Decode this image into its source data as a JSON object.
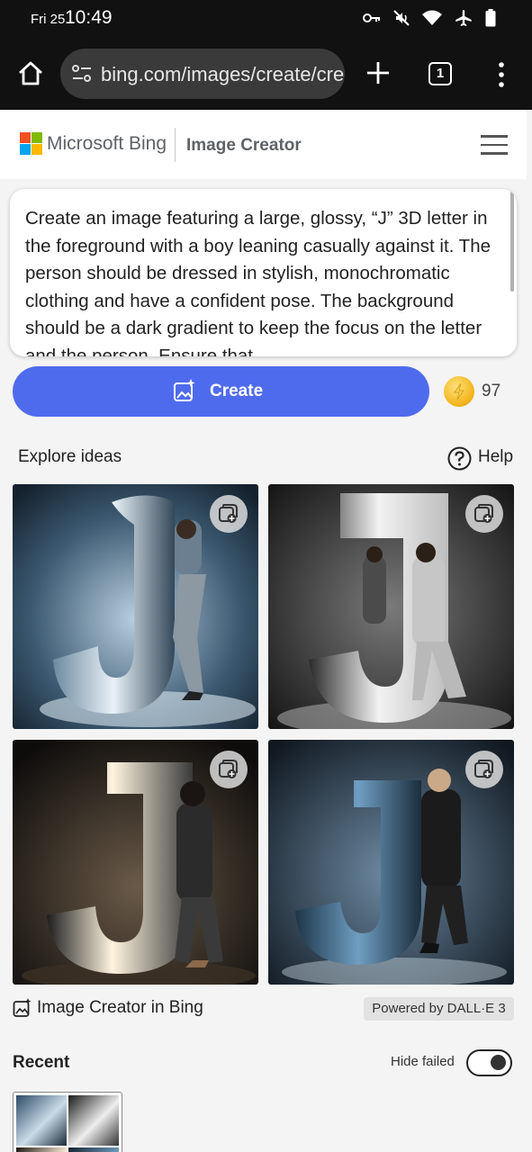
{
  "status_bar": {
    "date": "Fri 25",
    "time": "10:49",
    "icons": [
      "vpn-key-icon",
      "mute-icon",
      "wifi-icon",
      "airplane-icon",
      "battery-icon"
    ]
  },
  "browser": {
    "url": "bing.com/images/create/cre",
    "tab_count": "1"
  },
  "header": {
    "brand": "Microsoft Bing",
    "title": "Image Creator"
  },
  "prompt": {
    "text": "Create an image featuring a large, glossy, “J” 3D letter in the foreground with a boy leaning casually against it. The person should be dressed in stylish, monochromatic clothing and have a confident pose. The background should be a dark gradient to keep the focus on the letter and the person. Ensure that"
  },
  "create": {
    "label": "Create",
    "coins": "97"
  },
  "explore": {
    "label": "Explore ideas",
    "help": "Help"
  },
  "footer": {
    "creator_label": "Image Creator in Bing",
    "powered_by": "Powered by DALL·E 3"
  },
  "recent": {
    "label": "Recent",
    "hide_failed": "Hide failed",
    "hide_failed_on": true
  },
  "colors": {
    "accent": "#4f6bed",
    "toolbar": "#111111",
    "coin": "#f3b51f"
  }
}
